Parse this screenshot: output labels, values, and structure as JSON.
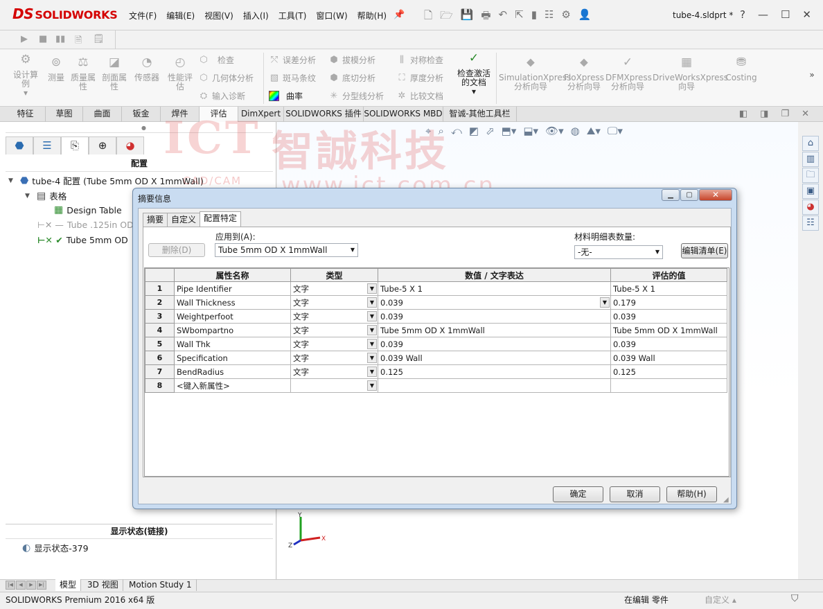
{
  "app": {
    "logo_text": "SOLIDWORKS",
    "logo_mark": "DS",
    "file_name": "tube-4.sldprt *",
    "menus": [
      "文件(F)",
      "编辑(E)",
      "视图(V)",
      "插入(I)",
      "工具(T)",
      "窗口(W)",
      "帮助(H)"
    ],
    "help_glyph": "?"
  },
  "ribbon": {
    "design_study": "设计算例",
    "measure": "测量",
    "mass_props": "质量属性",
    "section_props": "剖面属性",
    "sensor": "传感器",
    "perf_eval": "性能评估",
    "check": "检查",
    "geom_analysis": "几何体分析",
    "import_diag": "输入诊断",
    "deviation": "误差分析",
    "zebra": "斑马条纹",
    "curvature": "曲率",
    "draft": "拔模分析",
    "undercut": "底切分析",
    "parting": "分型线分析",
    "symmetry": "对称检查",
    "thickness": "厚度分析",
    "compare": "比较文档",
    "check_active": "检查激活的文档",
    "simxpress": "SimulationXpress 分析向导",
    "floxpress": "FloXpress 分析向导",
    "dfmxpress": "DFMXpress 分析向导",
    "driveworks": "DriveWorksXpress 向导",
    "costing": "Costing"
  },
  "command_tabs": [
    "特征",
    "草图",
    "曲面",
    "钣金",
    "焊件",
    "评估",
    "DimXpert",
    "SOLIDWORKS 插件",
    "SOLIDWORKS MBD",
    "智诚-其他工具栏"
  ],
  "left_panel": {
    "title": "配置",
    "root": "tube-4 配置  (Tube 5mm OD X 1mmWall)",
    "table_node": "表格",
    "design_table": "Design Table",
    "config1": "Tube .125in OD",
    "config2": "Tube 5mm OD",
    "display_title": "显示状态(链接)",
    "display_state": "显示状态-379"
  },
  "watermark": {
    "ict": "ICT",
    "cn": "智誠科技",
    "cad": "CAD/CAM",
    "url": "www.ict.com.cn"
  },
  "dialog": {
    "title": "摘要信息",
    "tabs": [
      "摘要",
      "自定义",
      "配置特定"
    ],
    "delete_label": "删除(D)",
    "apply_label": "应用到(A):",
    "apply_value": "Tube 5mm OD X 1mmWall",
    "bom_label": "材料明细表数量:",
    "bom_value": "-无-",
    "edit_list": "编辑清单(E)",
    "columns": [
      "属性名称",
      "类型",
      "数值 / 文字表达",
      "评估的值"
    ],
    "rows": [
      {
        "n": "1",
        "name": "Pipe Identifier",
        "type": "文字",
        "value": "Tube-5 X 1",
        "eval": "Tube-5 X 1"
      },
      {
        "n": "2",
        "name": "Wall Thickness",
        "type": "文字",
        "value": "0.039",
        "eval": "0.179"
      },
      {
        "n": "3",
        "name": "Weightperfoot",
        "type": "文字",
        "value": "0.039",
        "eval": "0.039"
      },
      {
        "n": "4",
        "name": "SWbompartno",
        "type": "文字",
        "value": "Tube 5mm OD X 1mmWall",
        "eval": "Tube 5mm OD X 1mmWall"
      },
      {
        "n": "5",
        "name": "Wall Thk",
        "type": "文字",
        "value": "0.039",
        "eval": "0.039"
      },
      {
        "n": "6",
        "name": "Specification",
        "type": "文字",
        "value": "0.039 Wall",
        "eval": "0.039 Wall"
      },
      {
        "n": "7",
        "name": "BendRadius",
        "type": "文字",
        "value": "0.125",
        "eval": "0.125"
      },
      {
        "n": "8",
        "name": "<键入新属性>",
        "type": "",
        "value": "",
        "eval": ""
      }
    ],
    "ok": "确定",
    "cancel": "取消",
    "help": "帮助(H)"
  },
  "bottom_tabs": [
    "模型",
    "3D 视图",
    "Motion Study 1"
  ],
  "status": {
    "left": "SOLIDWORKS Premium 2016 x64 版",
    "editing": "在编辑 零件",
    "custom": "自定义"
  },
  "triad": {
    "x": "X",
    "y": "Y",
    "z": "Z"
  },
  "colors": {
    "brand": "#d40000",
    "dialog_frame": "#c9dcf1",
    "axis_x": "#d02020",
    "axis_y": "#20a020",
    "axis_z": "#2030c0"
  }
}
